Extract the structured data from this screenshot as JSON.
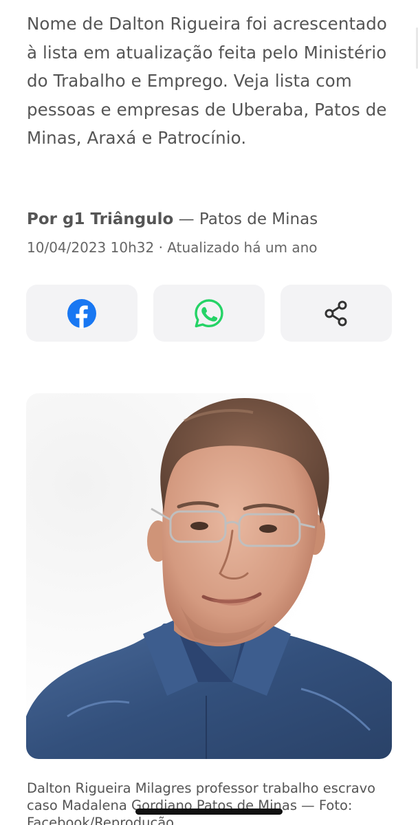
{
  "article": {
    "subtitle": "Nome de Dalton Rigueira foi acrescentado à lista em atualização feita pelo Ministério do Trabalho e Emprego. Veja lista com pessoas e empresas de Uberaba, Patos de Minas, Araxá e Patrocínio.",
    "byline": {
      "prefix": "Por ",
      "author": "g1 Triângulo",
      "separator": " — ",
      "location": "Patos de Minas"
    },
    "dateline": "10/04/2023 10h32 · Atualizado há um ano",
    "photo_caption": "Dalton Rigueira Milagres professor trabalho escravo caso Madalena Gordiano Patos de Minas — Foto: Facebook/Reprodução"
  },
  "share": {
    "buttons": [
      {
        "icon": "facebook-icon",
        "color": "#1877f2"
      },
      {
        "icon": "whatsapp-icon",
        "color": "#25d366"
      },
      {
        "icon": "share-icon",
        "color": "#333333"
      }
    ]
  }
}
